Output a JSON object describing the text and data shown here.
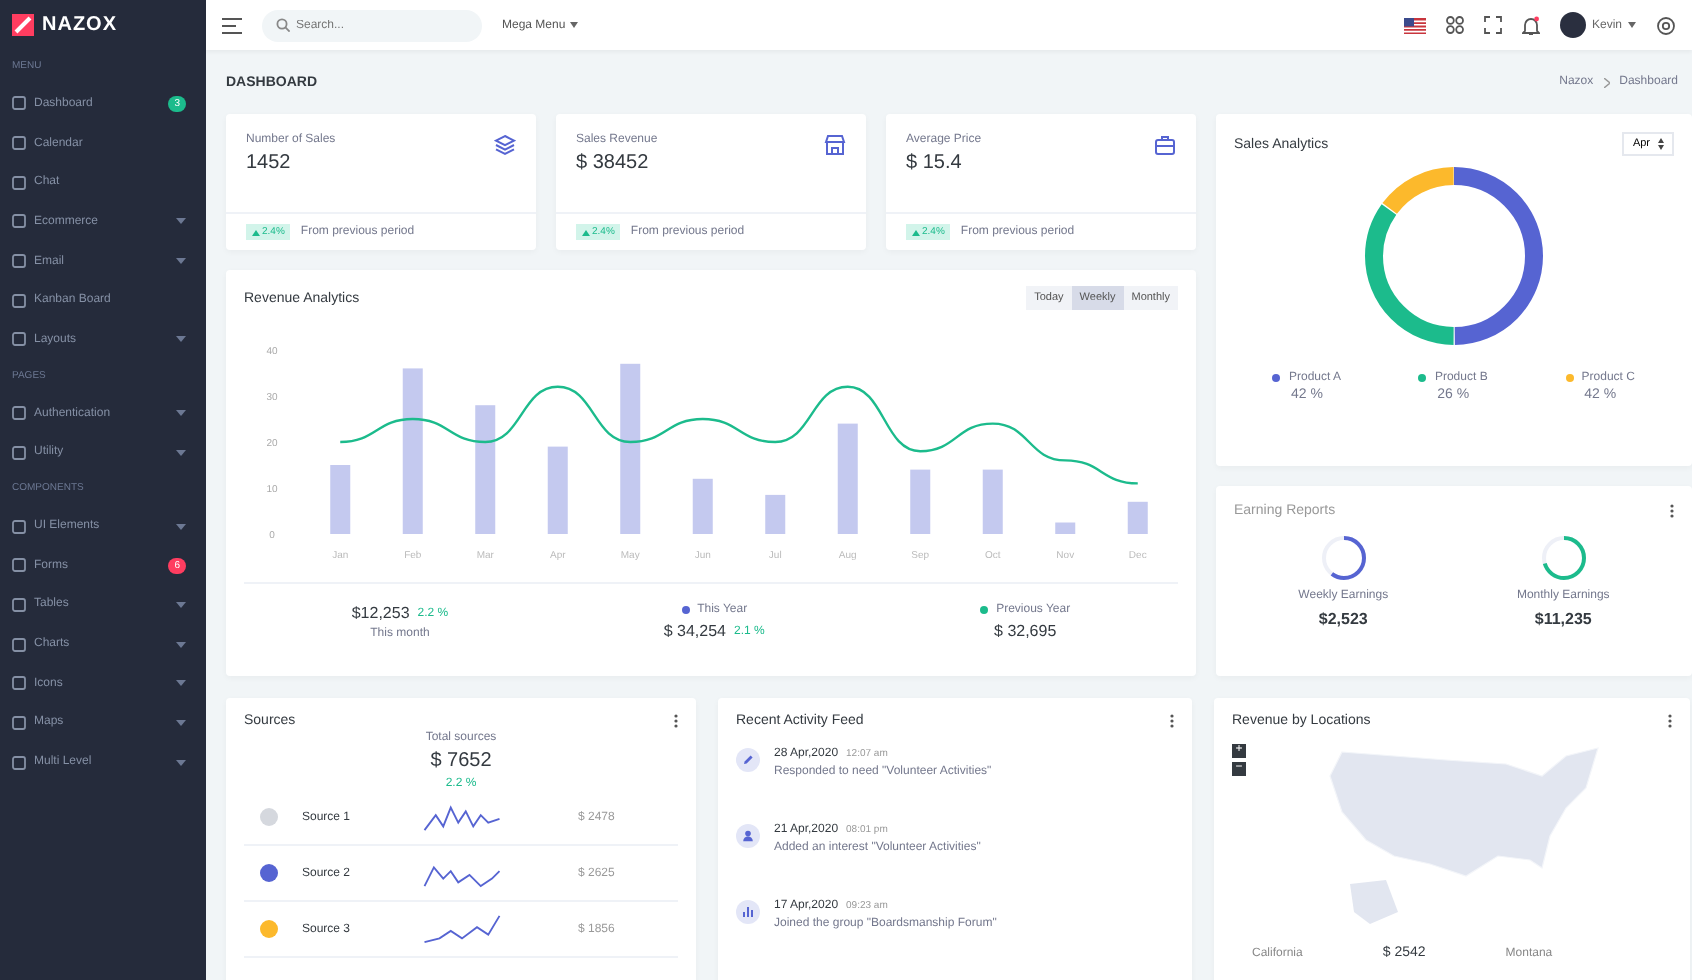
{
  "sidebar": {
    "logo": "NAZOX",
    "sections": [
      {
        "title": "MENU",
        "items": [
          {
            "label": "Dashboard",
            "kind": "link",
            "badge": "3",
            "color": "#1cbb8c"
          },
          {
            "label": "Calendar",
            "kind": "link"
          },
          {
            "label": "Chat",
            "kind": "link"
          },
          {
            "label": "Ecommerce",
            "kind": "submenu"
          },
          {
            "label": "Email",
            "kind": "submenu"
          },
          {
            "label": "Kanban Board",
            "kind": "link"
          },
          {
            "label": "Layouts",
            "kind": "submenu"
          }
        ]
      },
      {
        "title": "PAGES",
        "items": [
          {
            "label": "Authentication",
            "kind": "submenu"
          },
          {
            "label": "Utility",
            "kind": "submenu"
          }
        ]
      },
      {
        "title": "COMPONENTS",
        "items": [
          {
            "label": "UI Elements",
            "kind": "submenu"
          },
          {
            "label": "Forms",
            "kind": "link",
            "badge": "6",
            "color": "#ff3d60"
          },
          {
            "label": "Tables",
            "kind": "submenu"
          },
          {
            "label": "Charts",
            "kind": "submenu"
          },
          {
            "label": "Icons",
            "kind": "submenu"
          },
          {
            "label": "Maps",
            "kind": "submenu"
          },
          {
            "label": "Multi Level",
            "kind": "submenu"
          }
        ]
      }
    ]
  },
  "topbar": {
    "search": {
      "placeholder": "Search..."
    },
    "mega_menu": "Mega Menu",
    "user": "Kevin"
  },
  "page": {
    "title": "DASHBOARD",
    "breadcrumb": [
      "Nazox",
      "Dashboard"
    ]
  },
  "stats": [
    {
      "label": "Number of Sales",
      "value": "1452",
      "change": "2.4%",
      "note": "From previous period"
    },
    {
      "label": "Sales Revenue",
      "value": "$ 38452",
      "change": "2.4%",
      "note": "From previous period"
    },
    {
      "label": "Average Price",
      "value": "$ 15.4",
      "change": "2.4%",
      "note": "From previous period"
    }
  ],
  "revenue": {
    "title": "Revenue Analytics",
    "tabs": [
      {
        "label": "Today",
        "selected": false
      },
      {
        "label": "Weekly",
        "selected": true
      },
      {
        "label": "Monthly",
        "selected": false
      }
    ],
    "chart_data": {
      "type": "bar",
      "categories": [
        "Jan",
        "Feb",
        "Mar",
        "Apr",
        "May",
        "Jun",
        "Jul",
        "Aug",
        "Sep",
        "Oct",
        "Nov",
        "Dec"
      ],
      "yticks": [
        0,
        10,
        20,
        30,
        40
      ],
      "ylim": [
        0,
        40
      ],
      "series": [
        {
          "name": "This Year",
          "type": "bar",
          "color": "#5664d2",
          "values": [
            15,
            36,
            28,
            19,
            37,
            12,
            8.5,
            24,
            14,
            14,
            2.5,
            7
          ]
        },
        {
          "name": "Previous Year",
          "type": "line",
          "color": "#1cbb8c",
          "values": [
            20,
            25,
            20,
            32,
            20,
            25,
            20,
            32,
            18,
            24,
            16,
            11
          ]
        }
      ]
    },
    "summary": [
      {
        "kind": "month",
        "value": "$12,253",
        "change": "2.2 %",
        "label": "This month"
      },
      {
        "kind": "legend",
        "value": "$ 34,254",
        "change": "2.1 %"
      },
      {
        "kind": "legend",
        "value": "$ 32,695"
      }
    ]
  },
  "sales_analytics": {
    "title": "Sales Analytics",
    "select": "Apr",
    "legend": [
      {
        "label": "Product A",
        "value": "42 %",
        "color": "#5664d2"
      },
      {
        "label": "Product B",
        "value": "26 %",
        "color": "#1cbb8c"
      },
      {
        "label": "Product C",
        "value": "42 %",
        "color": "#fcb92c"
      }
    ]
  },
  "earning_reports": {
    "title": "Earning Reports",
    "items": [
      {
        "label": "Weekly Earnings",
        "value": "$2,523",
        "level": 0.6,
        "color": "#5664d2"
      },
      {
        "label": "Monthly Earnings",
        "value": "$11,235",
        "level": 0.7,
        "color": "#1cbb8c"
      }
    ]
  },
  "sources": {
    "title": "Sources",
    "total_label": "Total sources",
    "total": "$ 7652",
    "change": "2.2 %",
    "items": [
      {
        "name": "Source 1",
        "amount": "$ 2478",
        "color": "#d5d8de"
      },
      {
        "name": "Source 2",
        "amount": "$ 2625",
        "color": "#5664d2"
      },
      {
        "name": "Source 3",
        "amount": "$ 1856",
        "color": "#fcb92c"
      }
    ]
  },
  "activity": {
    "title": "Recent Activity Feed",
    "items": [
      {
        "date": "28 Apr,2020",
        "time": "12:07 am",
        "text": "Responded to need \"Volunteer Activities\""
      },
      {
        "date": "21 Apr,2020",
        "time": "08:01 pm",
        "text": "Added an interest \"Volunteer Activities\""
      },
      {
        "date": "17 Apr,2020",
        "time": "09:23 am",
        "text": "Joined the group \"Boardsmanship Forum\""
      }
    ]
  },
  "locations": {
    "title": "Revenue by Locations",
    "zoom_controls": [
      "+",
      "−"
    ],
    "items": [
      {
        "name": "California",
        "value": "$ 2542"
      },
      {
        "name": "Montana"
      }
    ]
  }
}
